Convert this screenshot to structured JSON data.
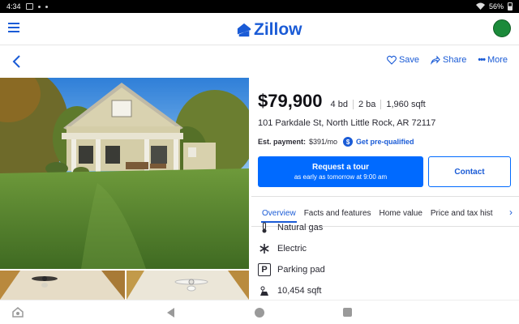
{
  "statusbar": {
    "time": "4:34",
    "battery": "56%"
  },
  "app": {
    "brand": "Zillow"
  },
  "nav": {
    "save": "Save",
    "share": "Share",
    "more": "More"
  },
  "listing": {
    "price": "$79,900",
    "beds": "4 bd",
    "baths": "2 ba",
    "sqft": "1,960 sqft",
    "address": "101 Parkdale St, North Little Rock, AR 72117",
    "est_label": "Est. payment:",
    "est_value": "$391/mo",
    "dollar_symbol": "$",
    "prequal": "Get pre-qualified"
  },
  "buttons": {
    "tour_title": "Request a tour",
    "tour_sub": "as early as tomorrow at 9:00 am",
    "contact": "Contact"
  },
  "tabs": [
    "Overview",
    "Facts and features",
    "Home value",
    "Price and tax hist"
  ],
  "features": [
    {
      "icon": "thermometer-icon",
      "label": "Natural gas"
    },
    {
      "icon": "snowflake-icon",
      "label": "Electric"
    },
    {
      "icon": "parking-icon",
      "glyph": "P",
      "label": "Parking pad"
    },
    {
      "icon": "lot-size-icon",
      "label": "10,454 sqft"
    }
  ],
  "colors": {
    "brand": "#1a5bd6",
    "button": "#006aff"
  }
}
